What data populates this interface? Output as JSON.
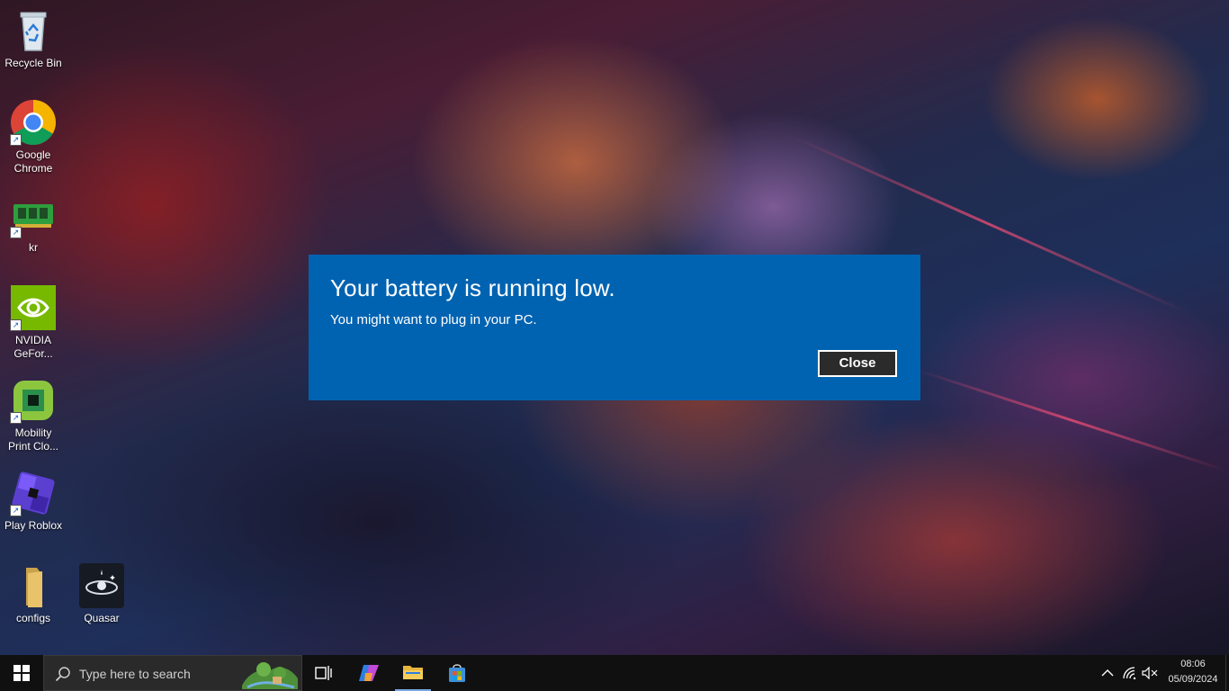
{
  "desktop": {
    "icons": [
      {
        "name": "recycle-bin",
        "label": "Recycle Bin"
      },
      {
        "name": "google-chrome",
        "label": "Google\nChrome"
      },
      {
        "name": "kr",
        "label": "kr"
      },
      {
        "name": "nvidia-geforce",
        "label": "NVIDIA\nGeFor..."
      },
      {
        "name": "mobility-print",
        "label": "Mobility\nPrint Clo..."
      },
      {
        "name": "play-roblox",
        "label": "Play Roblox"
      },
      {
        "name": "configs",
        "label": "configs"
      },
      {
        "name": "quasar",
        "label": "Quasar"
      }
    ]
  },
  "dialog": {
    "title": "Your battery is running low.",
    "message": "You might want to plug in your PC.",
    "close_label": "Close",
    "background_color": "#0063b1"
  },
  "taskbar": {
    "search_placeholder": "Type here to search",
    "pinned": [
      "task-view-icon",
      "copilot-icon",
      "file-explorer-icon",
      "microsoft-store-icon"
    ],
    "clock": {
      "time": "08:06",
      "date": "05/09/2024"
    }
  }
}
